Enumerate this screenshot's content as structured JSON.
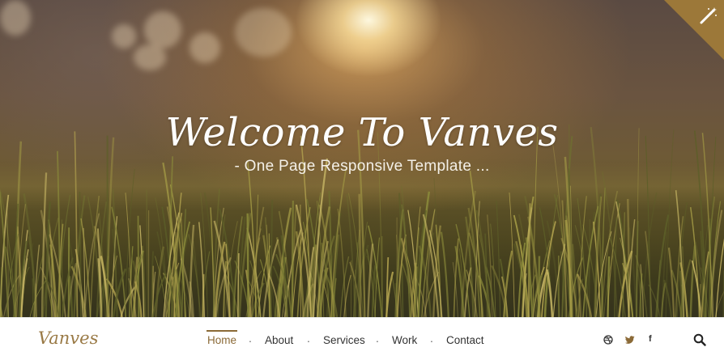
{
  "hero": {
    "title": "Welcome To Vanves",
    "subtitle": "- One Page Responsive Template ..."
  },
  "settings": {
    "icon": "magic-wand-icon"
  },
  "navbar": {
    "brand": "Vanves",
    "items": [
      {
        "label": "Home",
        "active": true
      },
      {
        "label": "About",
        "active": false
      },
      {
        "label": "Services",
        "active": false
      },
      {
        "label": "Work",
        "active": false
      },
      {
        "label": "Contact",
        "active": false
      }
    ],
    "separator": ".",
    "social": [
      "dribbble-icon",
      "twitter-icon",
      "facebook-icon"
    ],
    "facebook_glyph": "f",
    "search_icon": "search-icon"
  },
  "colors": {
    "accent": "#8b6a37",
    "brand": "#9a7a46",
    "corner": "#9c7839",
    "nav_text": "#333333"
  }
}
